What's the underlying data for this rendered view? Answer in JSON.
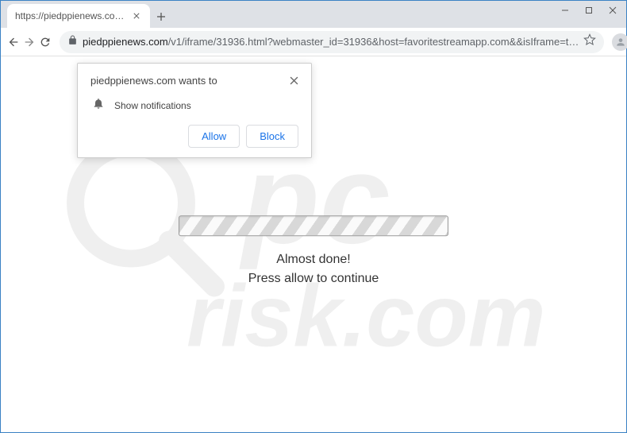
{
  "window": {
    "tab_title": "https://piedppienews.com/v1/ifr…"
  },
  "address": {
    "domain": "piedppienews.com",
    "path": "/v1/iframe/31936.html?webmaster_id=31936&host=favoritestreamapp.com&&isIframe=t…"
  },
  "permission": {
    "title": "piedppienews.com wants to",
    "item": "Show notifications",
    "allow": "Allow",
    "block": "Block"
  },
  "page": {
    "line1": "Almost done!",
    "line2": "Press allow to continue"
  },
  "watermark": {
    "top": "pc",
    "bottom": "risk.com"
  }
}
